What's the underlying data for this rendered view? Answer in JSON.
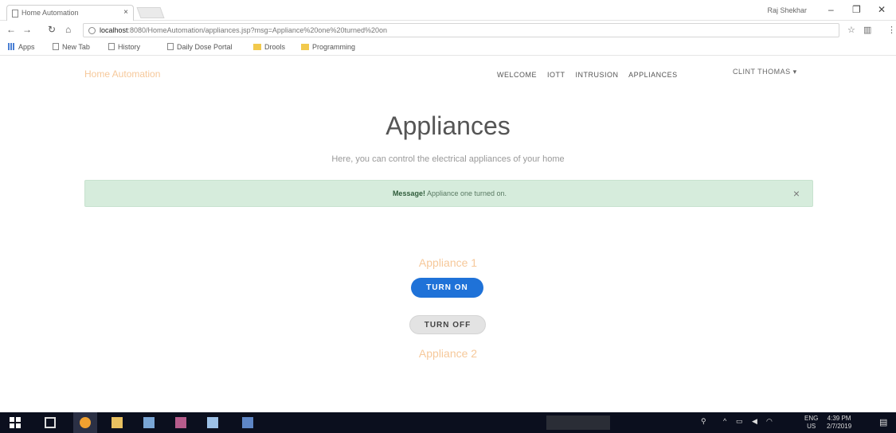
{
  "browser": {
    "tab_title": "Home Automation",
    "tab_close": "×",
    "window_user": "Raj Shekhar",
    "window_controls": {
      "minimize": "–",
      "restore": "❐",
      "close": "✕"
    },
    "nav": {
      "back": "←",
      "forward": "→",
      "reload": "↻",
      "home": "⌂"
    },
    "url_host": "localhost",
    "url_path": ":8080/HomeAutomation/appliances.jsp?msg=Appliance%20one%20turned%20on",
    "bookmarks": [
      "Apps",
      "New Tab",
      "History",
      "Daily Dose Portal",
      "Drools",
      "Programming"
    ],
    "right_icons": {
      "star": "☆",
      "ext": "▥",
      "menu": "⋮"
    }
  },
  "page": {
    "brand": "Home Automation",
    "nav_links": [
      "WELCOME",
      "IOTT",
      "INTRUSION",
      "APPLIANCES"
    ],
    "user_menu": "CLINT THOMAS ▾",
    "title": "Appliances",
    "subtitle": "Here, you can control the electrical appliances of your home",
    "alert": {
      "strong": "Message!",
      "text": " Appliance one turned on.",
      "close": "×"
    },
    "appliances": [
      {
        "name": "Appliance 1",
        "on_label": "TURN ON",
        "off_label": "TURN OFF"
      },
      {
        "name": "Appliance 2"
      }
    ]
  },
  "taskbar": {
    "lang_top": "ENG",
    "lang_bottom": "US",
    "time": "4:39 PM",
    "date": "2/7/2019"
  },
  "colors": {
    "alert_bg": "#d6ecdc",
    "on_button": "#1f72d8",
    "brand": "#f6c89a",
    "taskbar": "#0b0f1e"
  }
}
